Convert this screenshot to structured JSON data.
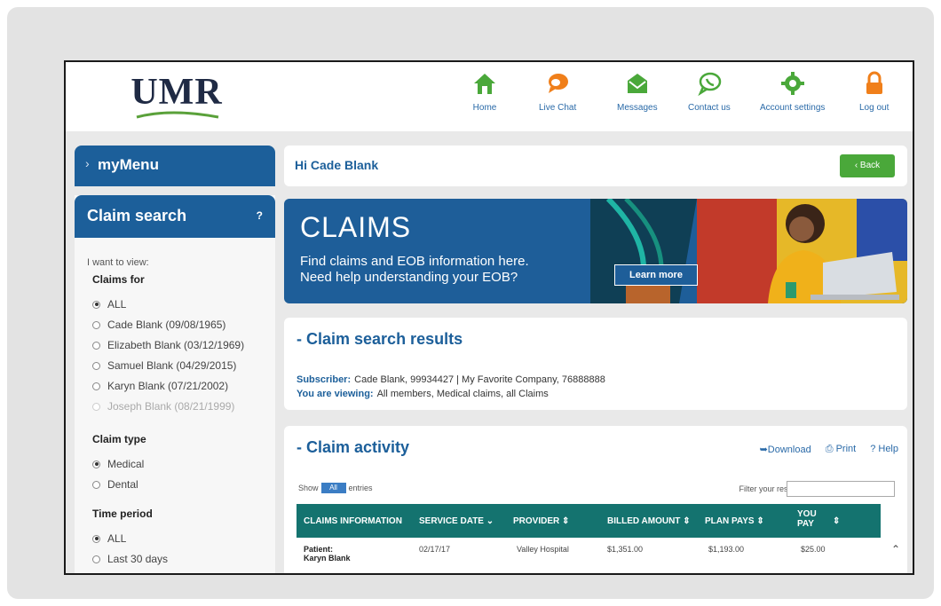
{
  "header": {
    "logo": "UMR",
    "nav": [
      {
        "label": "Home",
        "icon": "home-icon"
      },
      {
        "label": "Live Chat",
        "icon": "chat-icon"
      },
      {
        "label": "Messages",
        "icon": "envelope-icon"
      },
      {
        "label": "Contact us",
        "icon": "phone-bubble-icon"
      },
      {
        "label": "Account settings",
        "icon": "gear-icon"
      },
      {
        "label": "Log out",
        "icon": "lock-icon"
      }
    ]
  },
  "sidebar": {
    "mymenu": "myMenu",
    "claim_search": {
      "title": "Claim search",
      "help": "?",
      "intro": "I want to view:",
      "claims_for_label": "Claims for",
      "claims_for": [
        {
          "label": "ALL",
          "selected": true
        },
        {
          "label": "Cade Blank (09/08/1965)",
          "selected": false
        },
        {
          "label": "Elizabeth Blank (03/12/1969)",
          "selected": false
        },
        {
          "label": "Samuel Blank (04/29/2015)",
          "selected": false
        },
        {
          "label": "Karyn Blank (07/21/2002)",
          "selected": false
        },
        {
          "label": "Joseph Blank (08/21/1999)",
          "selected": false,
          "disabled": true
        }
      ],
      "claim_type_label": "Claim type",
      "claim_types": [
        {
          "label": "Medical",
          "selected": true
        },
        {
          "label": "Dental",
          "selected": false
        }
      ],
      "time_period_label": "Time period",
      "time_periods": [
        {
          "label": "ALL",
          "selected": true
        },
        {
          "label": "Last 30 days",
          "selected": false
        }
      ]
    }
  },
  "main": {
    "greeting": "Hi Cade Blank",
    "back": "‹ Back",
    "banner": {
      "title": "CLAIMS",
      "line1": "Find claims and EOB information here.",
      "line2": "Need help understanding your EOB?",
      "cta": "Learn more"
    },
    "results": {
      "title": "Claim search results",
      "subscriber_label": "Subscriber:",
      "subscriber_value": "Cade Blank, 99934427 | My Favorite Company, 76888888",
      "viewing_label": "You are viewing:",
      "viewing_value": "All members, Medical claims, all Claims"
    },
    "activity": {
      "title": "Claim activity",
      "download": "Download",
      "print": "Print",
      "help": "Help",
      "show": "Show",
      "show_value": "All",
      "entries": "entries",
      "filter": "Filter your results:",
      "columns": [
        "CLAIMS INFORMATION",
        "SERVICE DATE",
        "PROVIDER",
        "BILLED AMOUNT",
        "PLAN PAYS",
        "YOU PAY"
      ],
      "row": {
        "patient_label": "Patient:",
        "patient": "Karyn Blank",
        "service_date": "02/17/17",
        "provider": "Valley Hospital",
        "billed": "$1,351.00",
        "plan_pays": "$1,193.00",
        "you_pay": "$25.00"
      }
    }
  },
  "colors": {
    "brand_blue": "#1c5f9a",
    "teal": "#14736f",
    "green": "#4aa83a"
  }
}
